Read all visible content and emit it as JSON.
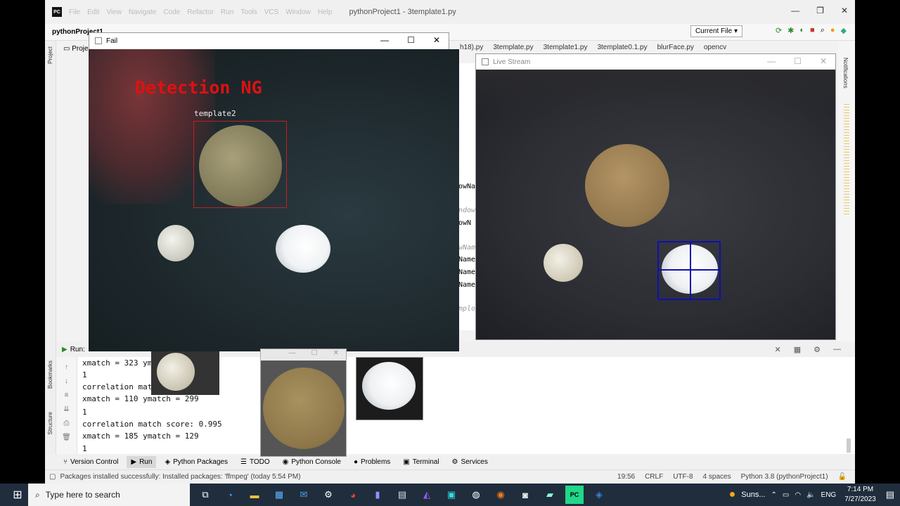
{
  "ide": {
    "title": "pythonProject1 - 3template1.py",
    "menu": [
      "File",
      "Edit",
      "View",
      "Navigate",
      "Code",
      "Refactor",
      "Run",
      "Tools",
      "VCS",
      "Window",
      "Help"
    ],
    "project": "pythonProject1",
    "project_tab": "Proje",
    "run_config": "Current File",
    "editor_tabs": [
      "h18).py",
      "3template.py",
      "3template1.py",
      "3template0.1.py",
      "blurFace.py",
      "opencv"
    ],
    "code_lines": [
      "owNa",
      "ndow",
      "owN",
      "wNam",
      "Name",
      "Name",
      "Name",
      "mplo"
    ],
    "side_labels": {
      "project": "Project",
      "bookmarks": "Bookmarks",
      "structure": "Structure",
      "notifications": "Notifications"
    },
    "run_label": "Run:",
    "console": [
      "xmatch = 323 yma",
      "1",
      "correlation matc",
      "xmatch = 110 ymatch = 299",
      "1",
      "correlation match score: 0.995",
      "xmatch = 185 ymatch = 129",
      "1"
    ],
    "bottom_tabs": [
      {
        "icon": "version-control-icon",
        "label": "Version Control"
      },
      {
        "icon": "run-icon",
        "label": "Run"
      },
      {
        "icon": "python-packages-icon",
        "label": "Python Packages"
      },
      {
        "icon": "todo-icon",
        "label": "TODO"
      },
      {
        "icon": "python-console-icon",
        "label": "Python Console"
      },
      {
        "icon": "problems-icon",
        "label": "Problems"
      },
      {
        "icon": "terminal-icon",
        "label": "Terminal"
      },
      {
        "icon": "services-icon",
        "label": "Services"
      }
    ],
    "status": "Packages installed successfully: Installed packages: 'ffmpeg' (today 5:54 PM)",
    "status_right": [
      "19:56",
      "CRLF",
      "UTF-8",
      "4 spaces",
      "Python 3.8 (pythonProject1)"
    ]
  },
  "fail_window": {
    "title": "Fail",
    "overlay_text": "Detection NG",
    "box_label": "template2"
  },
  "live_window": {
    "title": "Live Stream"
  },
  "taskbar": {
    "search_placeholder": "Type here to search",
    "weather": "Suns...",
    "lang": "ENG",
    "time": "7:14 PM",
    "date": "7/27/2023"
  },
  "colors": {
    "ng_red": "#e01010",
    "detect_blue": "#1010b0",
    "taskbar": "#1f2d3d"
  }
}
